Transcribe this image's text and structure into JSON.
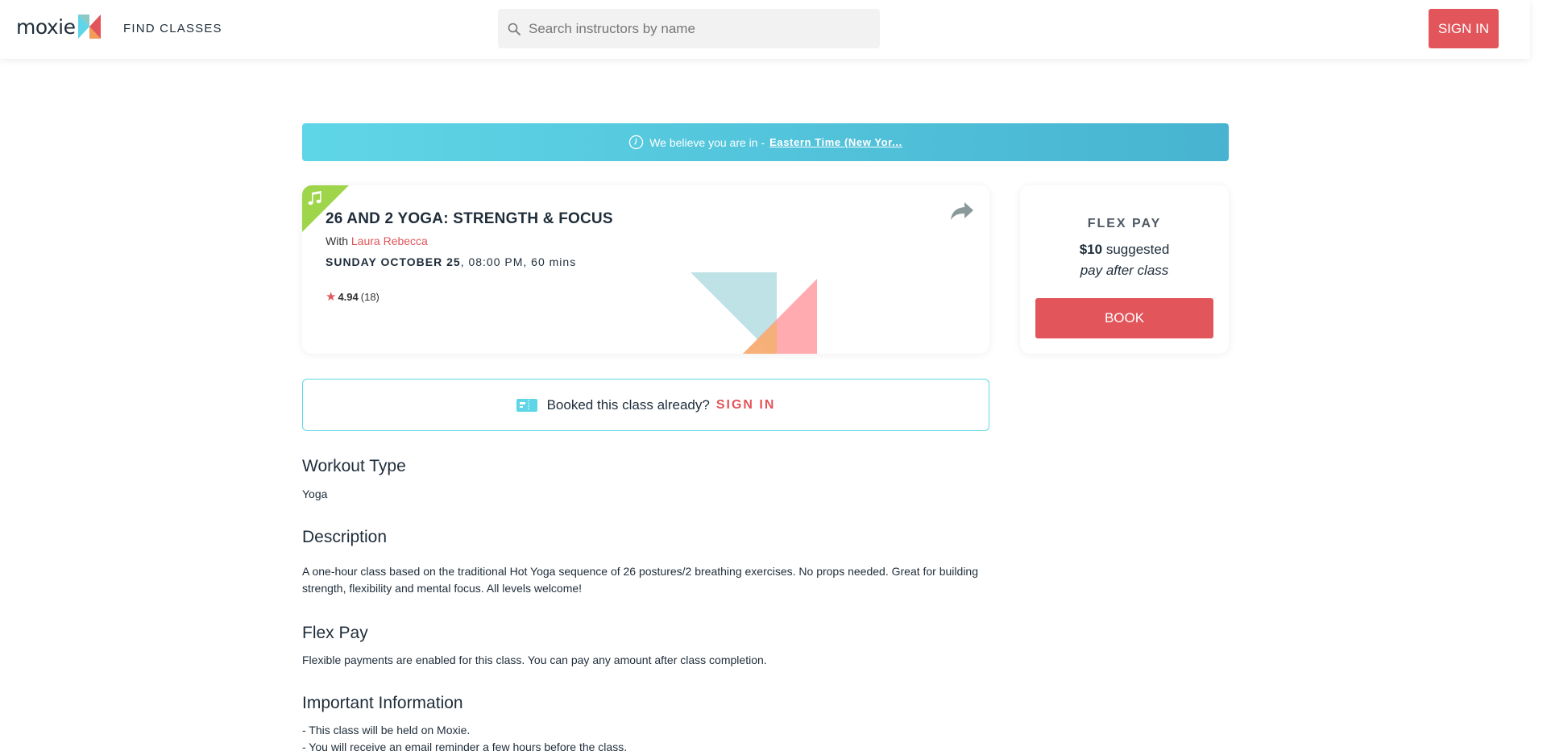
{
  "header": {
    "logo_text": "moxie",
    "find_classes": "FIND CLASSES",
    "search_placeholder": "Search instructors by name",
    "sign_in": "SIGN IN"
  },
  "timezone_banner": {
    "prefix": "We believe you are in -",
    "timezone": "Eastern Time (New Yor..."
  },
  "class": {
    "title": "26 AND 2 YOGA: STRENGTH & FOCUS",
    "with_label": "With",
    "instructor": "Laura Rebecca",
    "day_date": "SUNDAY OCTOBER 25",
    "time_duration": ", 08:00 PM, 60 mins",
    "rating": "4.94",
    "rating_count": "(18)",
    "badge_icon": "music-note-icon"
  },
  "flex_card": {
    "title": "FLEX PAY",
    "price": "$10",
    "suggested": "suggested",
    "pay_after": "pay after class",
    "book": "BOOK"
  },
  "booked": {
    "text": "Booked this class already?",
    "sign_in": "SIGN IN"
  },
  "sections": {
    "workout_type_heading": "Workout Type",
    "workout_type_value": "Yoga",
    "description_heading": "Description",
    "description_text": "A one-hour class based on the traditional Hot Yoga sequence of 26 postures/2 breathing exercises. No props needed. Great for building strength, flexibility and mental focus. All levels welcome!",
    "flex_pay_heading": "Flex Pay",
    "flex_pay_text": "Flexible payments are enabled for this class. You can pay any amount after class completion.",
    "important_heading": "Important Information",
    "important_line1": "- This class will be held on Moxie.",
    "important_line2": "- You will receive an email reminder a few hours before the class."
  },
  "colors": {
    "accent_red": "#e2555b",
    "banner_teal": "#5fd6e7",
    "badge_green": "#9fd54a"
  }
}
